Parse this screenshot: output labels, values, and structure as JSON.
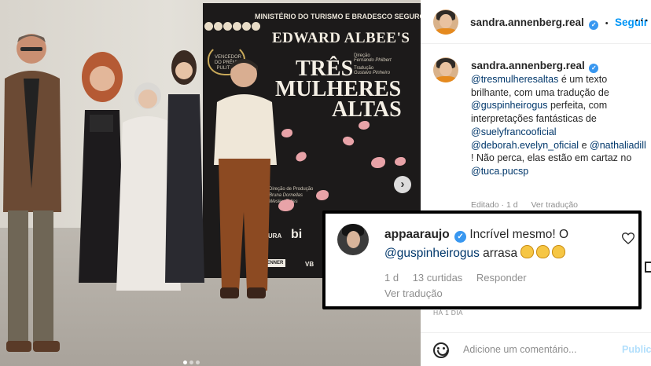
{
  "photo": {
    "poster": {
      "ministry_text": "MINISTÉRIO DO TURISMO E BRADESCO SEGUROS apre",
      "author": "EDWARD ALBEE'S",
      "title_line1": "TRÊS",
      "title_line2": "MULHERES",
      "title_line3": "ALTAS",
      "award_text": "VENCEDOR DO PRÊMIO PULITZER",
      "direction_label": "Direção",
      "director": "Fernando Philbert",
      "translation_label": "Tradução",
      "translator": "Gustavo Pinheiro",
      "production_label": "Direção de Produção",
      "producers_line1": "Bruna Dornellas",
      "producers_line2": "Wesley Telles",
      "sponsor_1": "TURA",
      "sponsor_2": "bi",
      "sponsor_3": "RENNER",
      "sponsor_4": "VB"
    },
    "carousel_next": "›",
    "dots": 3,
    "active_dot": 0
  },
  "post": {
    "header_username": "sandra.annenberg.real",
    "separator": "•",
    "follow_label": "Seguir",
    "more_label": "···",
    "caption_username": "sandra.annenberg.real",
    "caption_segments": [
      {
        "text": "@tresmulheresaltas",
        "mention": true
      },
      {
        "text": " é um texto brilhante, com uma tradução de ",
        "mention": false
      },
      {
        "text": "@guspinheirogus",
        "mention": true
      },
      {
        "text": " perfeita, com interpretações fantásticas de ",
        "mention": false
      },
      {
        "text": "@suelyfrancooficial",
        "mention": true
      },
      {
        "text": " ",
        "mention": false
      },
      {
        "text": "@deborah.evelyn_oficial",
        "mention": true
      },
      {
        "text": " e ",
        "mention": false
      },
      {
        "text": "@nathaliadill",
        "mention": true
      },
      {
        "text": " ! Não perca, elas estão em cartaz no ",
        "mention": false
      },
      {
        "text": "@tuca.pucsp",
        "mention": true
      }
    ],
    "meta_edited": "Editado · 1 d",
    "meta_translate": "Ver tradução",
    "date_small": "HÁ 1 DIA",
    "comment_placeholder": "Adicione um comentário...",
    "publish_label": "Publicar"
  },
  "highlighted_comment": {
    "username": "appaaraujo",
    "text_before": " Incrível mesmo! O ",
    "mention": "@guspinheirogus",
    "text_after": " arrasa ",
    "emoji_name": "clapping-hands",
    "emoji_count": 3,
    "age": "1 d",
    "likes": "13 curtidas",
    "reply_label": "Responder",
    "translate_label": "Ver tradução"
  },
  "colors": {
    "link": "#00376b",
    "follow": "#0095f6",
    "verified": "#3897f0",
    "muted": "#8e8e8e",
    "overlay_border": "#000000"
  }
}
